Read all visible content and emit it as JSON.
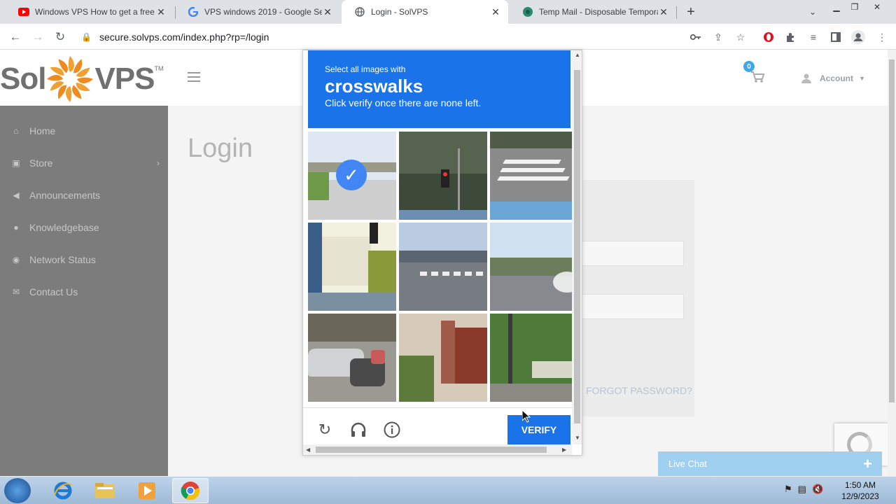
{
  "browser": {
    "tabs": [
      {
        "title": "Windows VPS How to get a free",
        "favicon": "youtube-icon",
        "active": false
      },
      {
        "title": "VPS windows 2019 - Google Sear",
        "favicon": "google-icon",
        "active": false
      },
      {
        "title": "Login - SolVPS",
        "favicon": "globe-icon",
        "active": true
      },
      {
        "title": "Temp Mail - Disposable Tempora",
        "favicon": "tempmail-icon",
        "active": false
      }
    ],
    "url": "secure.solvps.com/index.php?rp=/login"
  },
  "site": {
    "logo_left": "Sol",
    "logo_right": "VPS",
    "logo_tm": "TM",
    "cart_count": "0",
    "account_label": "Account",
    "nav": [
      {
        "label": "Home",
        "icon": "home-icon"
      },
      {
        "label": "Store",
        "icon": "basket-icon"
      },
      {
        "label": "Announcements",
        "icon": "megaphone-icon"
      },
      {
        "label": "Knowledgebase",
        "icon": "info-icon"
      },
      {
        "label": "Network Status",
        "icon": "network-icon"
      },
      {
        "label": "Contact Us",
        "icon": "envelope-icon"
      }
    ],
    "page_title": "Login",
    "forgot_password": "FORGOT PASSWORD?",
    "live_chat": "Live Chat"
  },
  "captcha": {
    "instruction_small": "Select all images with",
    "target": "crosswalks",
    "instruction_sub": "Click verify once there are none left.",
    "verify_label": "VERIFY",
    "tiles_selected": [
      true,
      false,
      false,
      false,
      false,
      false,
      false,
      false,
      false
    ]
  },
  "taskbar": {
    "time": "1:50 AM",
    "date": "12/9/2023"
  },
  "colors": {
    "captcha_blue": "#1a73e8",
    "sidebar": "#7c7c7c",
    "live_chat": "#9fd0ef"
  }
}
